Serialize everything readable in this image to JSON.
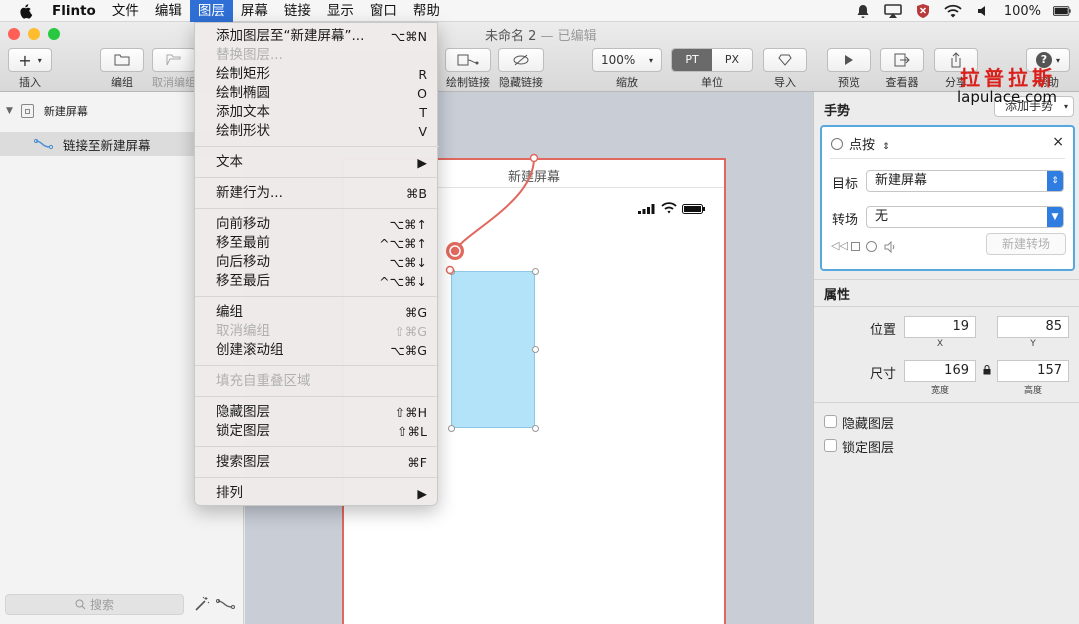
{
  "menubar": {
    "app_name": "Flinto",
    "items": [
      "文件",
      "编辑",
      "图层",
      "屏幕",
      "链接",
      "显示",
      "窗口",
      "帮助"
    ],
    "active_index": 2,
    "battery": "100%"
  },
  "window": {
    "title": "未命名 2",
    "edited_label": "— 已编辑"
  },
  "toolbar": {
    "insert_label": "插入",
    "group_label": "编组",
    "ungroup_label": "取消编组",
    "draw_link_label": "绘制链接",
    "hide_link_label": "隐藏链接",
    "zoom_value": "100%",
    "zoom_label": "缩放",
    "unit_pt": "PT",
    "unit_px": "PX",
    "unit_label": "单位",
    "import_label": "导入",
    "preview_label": "预览",
    "viewer_label": "查看器",
    "share_label": "分享",
    "help_label": "帮助"
  },
  "sidebar": {
    "screen_name": "新建屏幕",
    "link_name": "链接至新建屏幕",
    "search_placeholder": "搜索"
  },
  "canvas": {
    "screen_title": "新建屏幕"
  },
  "menu": {
    "items": [
      {
        "label": "添加图层至“新建屏幕”...",
        "shortcut": "⌥⌘N",
        "disabled": false
      },
      {
        "label": "替换图层...",
        "shortcut": "",
        "disabled": true
      },
      {
        "label": "绘制矩形",
        "shortcut": "R",
        "disabled": false
      },
      {
        "label": "绘制椭圆",
        "shortcut": "O",
        "disabled": false
      },
      {
        "label": "添加文本",
        "shortcut": "T",
        "disabled": false
      },
      {
        "label": "绘制形状",
        "shortcut": "V",
        "disabled": false
      },
      {
        "label": "文本",
        "shortcut": "▶",
        "disabled": false
      },
      {
        "label": "新建行为...",
        "shortcut": "⌘B",
        "disabled": false
      },
      {
        "label": "向前移动",
        "shortcut": "⌥⌘↑",
        "disabled": false
      },
      {
        "label": "移至最前",
        "shortcut": "^⌥⌘↑",
        "disabled": false
      },
      {
        "label": "向后移动",
        "shortcut": "⌥⌘↓",
        "disabled": false
      },
      {
        "label": "移至最后",
        "shortcut": "^⌥⌘↓",
        "disabled": false
      },
      {
        "label": "编组",
        "shortcut": "⌘G",
        "disabled": false
      },
      {
        "label": "取消编组",
        "shortcut": "⇧⌘G",
        "disabled": true
      },
      {
        "label": "创建滚动组",
        "shortcut": "⌥⌘G",
        "disabled": false
      },
      {
        "label": "填充自重叠区域",
        "shortcut": "",
        "disabled": true
      },
      {
        "label": "隐藏图层",
        "shortcut": "⇧⌘H",
        "disabled": false
      },
      {
        "label": "锁定图层",
        "shortcut": "⇧⌘L",
        "disabled": false
      },
      {
        "label": "搜索图层",
        "shortcut": "⌘F",
        "disabled": false
      },
      {
        "label": "排列",
        "shortcut": "▶",
        "disabled": false
      }
    ]
  },
  "inspector": {
    "gesture_header": "手势",
    "add_gesture_label": "添加手势",
    "gesture_type": "点按",
    "target_label": "目标",
    "target_value": "新建屏幕",
    "transition_label": "转场",
    "transition_value": "无",
    "new_transition_label": "新建转场",
    "properties_header": "属性",
    "position_label": "位置",
    "x_value": "19",
    "y_value": "85",
    "x_sub": "X",
    "y_sub": "Y",
    "size_label": "尺寸",
    "width_value": "169",
    "height_value": "157",
    "width_sub": "宽度",
    "height_sub": "高度",
    "hide_layer_label": "隐藏图层",
    "lock_layer_label": "锁定图层"
  },
  "watermark": {
    "cn": "拉普拉斯",
    "en": "lapulace.com"
  },
  "colors": {
    "accent": "#2f6fd6",
    "link_red": "#e0685e",
    "selection_fill": "#b3e3f9",
    "focus_blue": "#58a8e0"
  }
}
